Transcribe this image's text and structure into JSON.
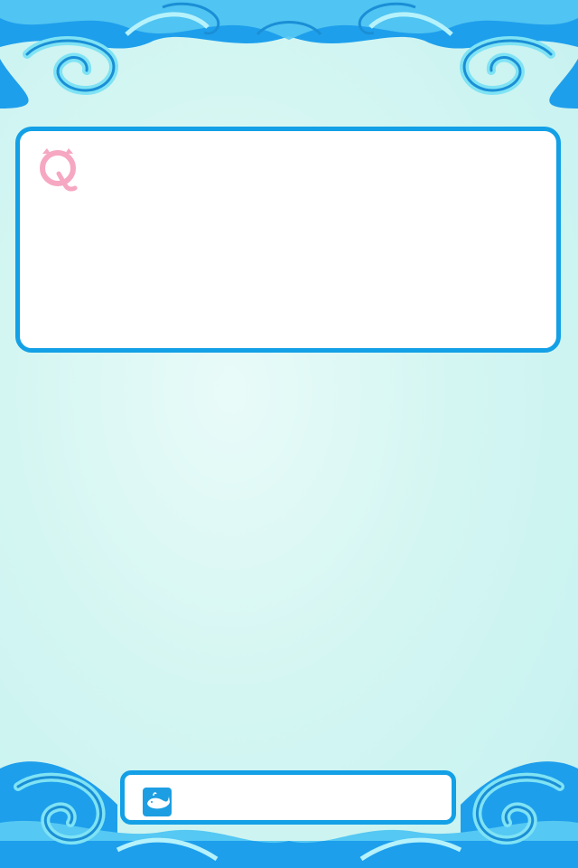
{
  "question": {
    "badge_letter": "Q",
    "text": ""
  },
  "answer": {
    "text": "",
    "icon": "whale-icon"
  },
  "colors": {
    "frame_blue": "#13a0e6",
    "frame_light": "#7fe3f4",
    "badge_pink": "#f6a7c1",
    "background": "#d4f6f2"
  }
}
